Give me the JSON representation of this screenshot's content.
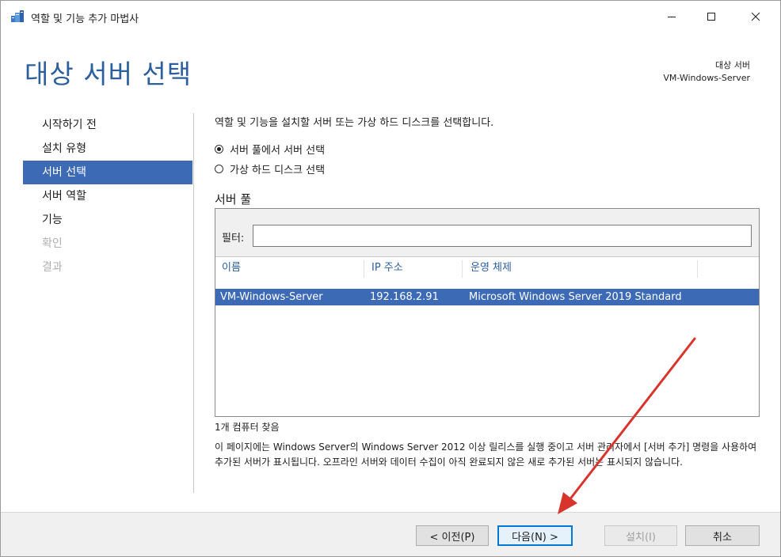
{
  "window": {
    "title": "역할 및 기능 추가 마법사",
    "minimize_icon": "minimize-icon",
    "maximize_icon": "maximize-icon",
    "close_icon": "close-icon"
  },
  "header": {
    "page_title": "대상 서버 선택",
    "destination_label": "대상 서버",
    "destination_value": "VM-Windows-Server"
  },
  "nav": {
    "items": [
      {
        "label": "시작하기 전",
        "state": "normal"
      },
      {
        "label": "설치 유형",
        "state": "normal"
      },
      {
        "label": "서버 선택",
        "state": "active"
      },
      {
        "label": "서버 역할",
        "state": "normal"
      },
      {
        "label": "기능",
        "state": "normal"
      },
      {
        "label": "확인",
        "state": "disabled"
      },
      {
        "label": "결과",
        "state": "disabled"
      }
    ]
  },
  "content": {
    "description": "역할 및 기능을 설치할 서버 또는 가상 하드 디스크를 선택합니다.",
    "radio_pool": "서버 풀에서 서버 선택",
    "radio_vhd": "가상 하드 디스크 선택",
    "selected_option": "radio_pool",
    "section_title": "서버 풀",
    "filter_label": "필터:",
    "filter_value": "",
    "columns": [
      "이름",
      "IP 주소",
      "운영 체제"
    ],
    "rows": [
      {
        "name": "VM-Windows-Server",
        "ip": "192.168.2.91",
        "os": "Microsoft Windows Server 2019 Standard",
        "selected": true
      }
    ],
    "found_text": "1개 컴퓨터 찾음",
    "info_text": "이 페이지에는 Windows Server의 Windows Server 2012 이상 릴리스를 실행 중이고 서버 관리자에서 [서버 추가] 명령을 사용하여 추가된 서버가 표시됩니다. 오프라인 서버와 데이터 수집이 아직 완료되지 않은 새로 추가된 서버는 표시되지 않습니다."
  },
  "buttons": {
    "prev": "< 이전(P)",
    "next": "다음(N) >",
    "install": "설치(I)",
    "cancel": "취소"
  },
  "colors": {
    "accent": "#3c6ab5",
    "title": "#2b5f9e",
    "annotation_arrow": "#d9342b"
  }
}
